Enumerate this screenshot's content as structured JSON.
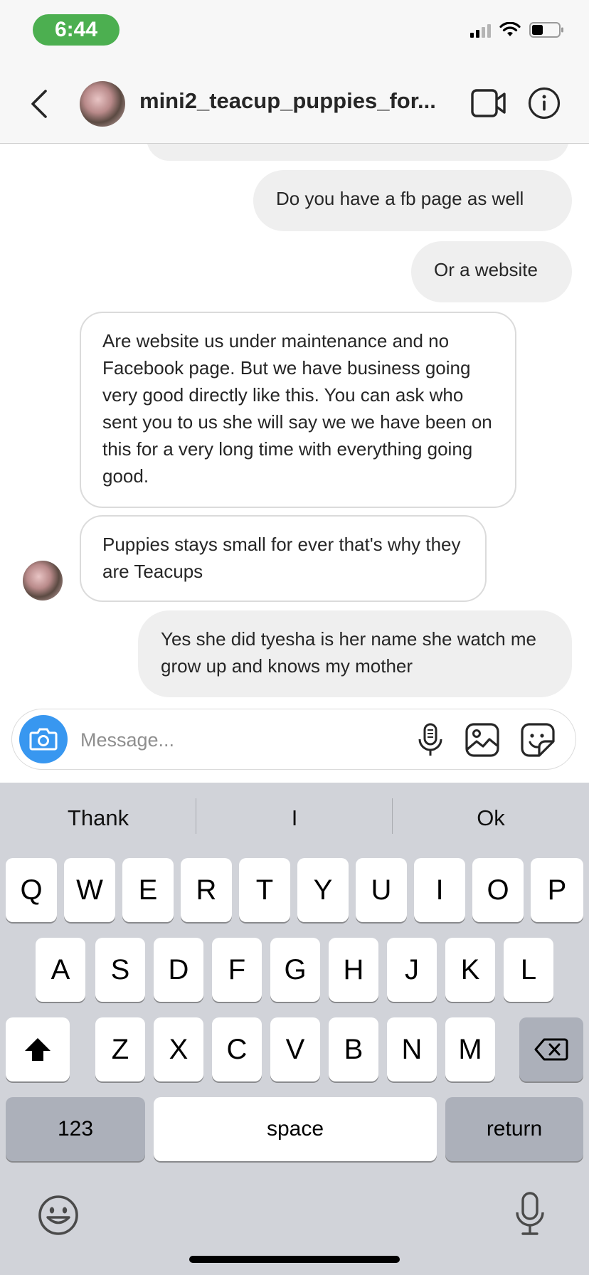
{
  "status_bar": {
    "time": "6:44"
  },
  "header": {
    "title": "mini2_teacup_puppies_for..."
  },
  "messages": [
    {
      "id": "m1",
      "direction": "outgoing",
      "text": "Do you have a fb page as well"
    },
    {
      "id": "m2",
      "direction": "outgoing",
      "text": "Or a website"
    },
    {
      "id": "m3",
      "direction": "incoming",
      "text": "Are website us under maintenance and no Facebook page. But we have business going very good directly like this. You can ask who sent you to us she will say we  we have been on this for a very long time with everything going good."
    },
    {
      "id": "m4",
      "direction": "incoming",
      "text": "Puppies stays small for ever that's why they are Teacups"
    },
    {
      "id": "m5",
      "direction": "outgoing",
      "text": "Yes she did tyesha is her name she watch me grow up and knows my mother"
    }
  ],
  "composer": {
    "placeholder": "Message...",
    "value": ""
  },
  "keyboard": {
    "suggestions": [
      "Thank",
      "I",
      "Ok"
    ],
    "row1": [
      "Q",
      "W",
      "E",
      "R",
      "T",
      "Y",
      "U",
      "I",
      "O",
      "P"
    ],
    "row2": [
      "A",
      "S",
      "D",
      "F",
      "G",
      "H",
      "J",
      "K",
      "L"
    ],
    "row3": [
      "Z",
      "X",
      "C",
      "V",
      "B",
      "N",
      "M"
    ],
    "numbers_label": "123",
    "space_label": "space",
    "return_label": "return"
  },
  "colors": {
    "status_pill": "#4caf50",
    "camera_button": "#3897f0",
    "outgoing_bubble": "#efefef",
    "keyboard_bg": "#d1d3d9"
  }
}
